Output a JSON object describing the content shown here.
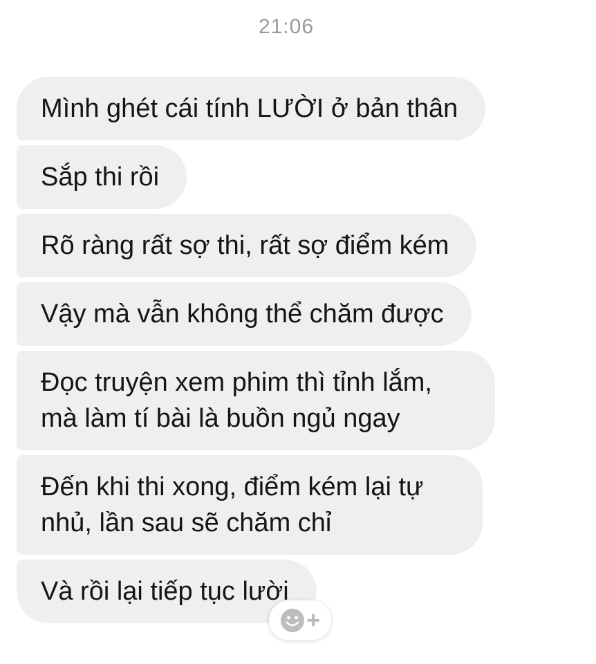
{
  "chat": {
    "timestamp": "21:06",
    "messages": [
      "Mình ghét cái tính LƯỜI ở bản thân",
      "Sắp thi rồi",
      "Rõ ràng rất sợ thi, rất sợ điểm kém",
      "Vậy mà vẫn không thể chăm được",
      "Đọc truyện xem phim thì tỉnh lắm, mà làm tí bài là buồn ngủ ngay",
      "Đến khi thi xong, điểm kém lại tự nhủ, lần sau sẽ chăm chỉ",
      "Và rồi lại tiếp tục lười"
    ],
    "reaction_button": {
      "icon": "smiley-add-icon",
      "plus": "+"
    }
  },
  "colors": {
    "bubble_bg": "#efefef",
    "text": "#151515",
    "timestamp": "#9a9a9a"
  }
}
